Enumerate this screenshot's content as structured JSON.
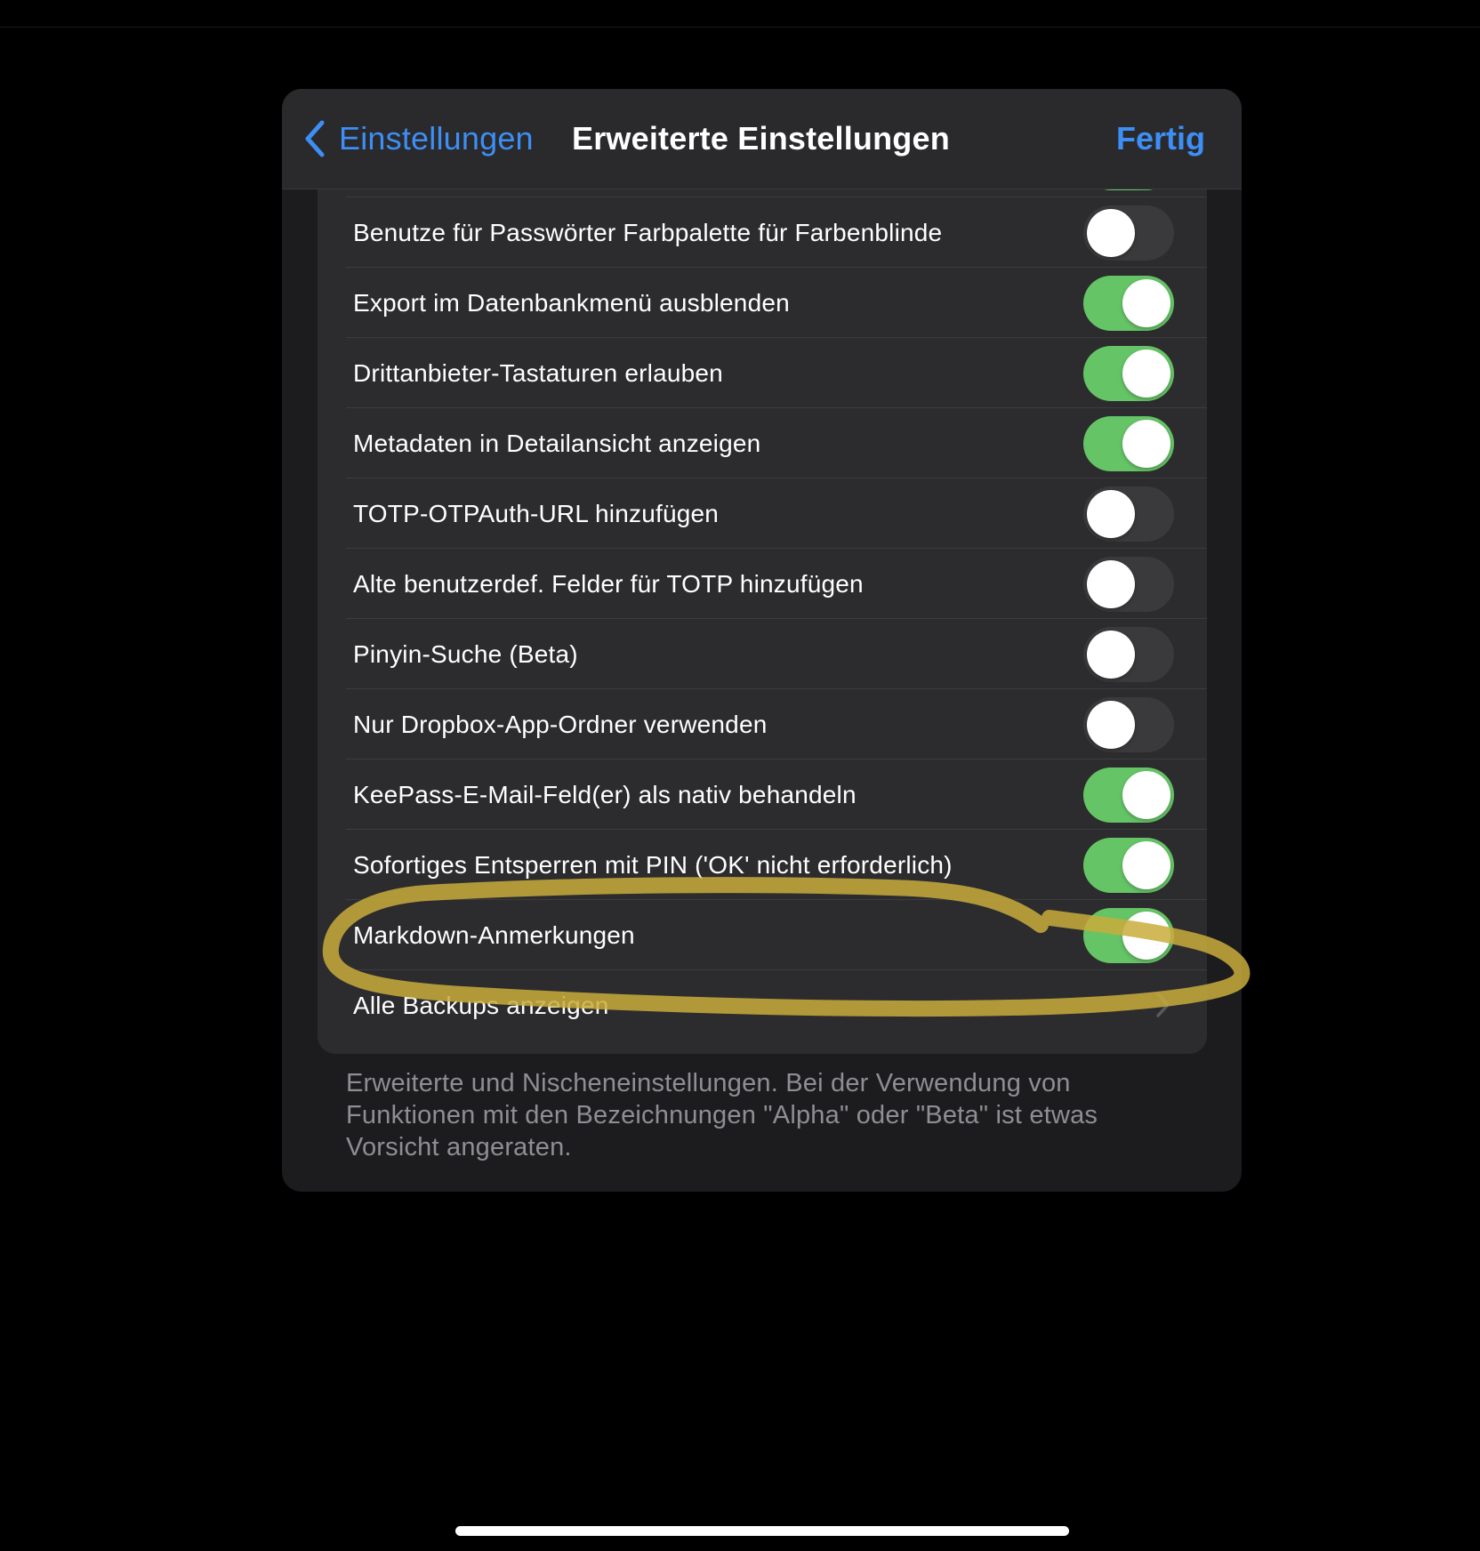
{
  "nav": {
    "back_label": "Einstellungen",
    "title": "Erweiterte Einstellungen",
    "done_label": "Fertig"
  },
  "rows": [
    {
      "label": "",
      "type": "toggle",
      "on": true
    },
    {
      "label": "Benutze für Passwörter Farbpalette für Farbenblinde",
      "type": "toggle",
      "on": false
    },
    {
      "label": "Export im Datenbankmenü ausblenden",
      "type": "toggle",
      "on": true
    },
    {
      "label": "Drittanbieter-Tastaturen erlauben",
      "type": "toggle",
      "on": true
    },
    {
      "label": "Metadaten in Detailansicht anzeigen",
      "type": "toggle",
      "on": true
    },
    {
      "label": "TOTP-OTPAuth-URL hinzufügen",
      "type": "toggle",
      "on": false
    },
    {
      "label": "Alte benutzerdef. Felder für TOTP hinzufügen",
      "type": "toggle",
      "on": false
    },
    {
      "label": "Pinyin-Suche (Beta)",
      "type": "toggle",
      "on": false
    },
    {
      "label": "Nur Dropbox-App-Ordner verwenden",
      "type": "toggle",
      "on": false
    },
    {
      "label": "KeePass-E-Mail-Feld(er) als nativ behandeln",
      "type": "toggle",
      "on": true
    },
    {
      "label": "Sofortiges Entsperren mit PIN ('OK' nicht erforderlich)",
      "type": "toggle",
      "on": true
    },
    {
      "label": "Markdown-Anmerkungen",
      "type": "toggle",
      "on": true
    },
    {
      "label": "Alle Backups anzeigen",
      "type": "link"
    }
  ],
  "footer": "Erweiterte und Nischeneinstellungen. Bei der Verwendung von Funktionen mit den Bezeichnungen \"Alpha\" oder \"Beta\" ist etwas Vorsicht angeraten.",
  "colors": {
    "accent": "#3d8ef5",
    "toggle_on": "#65c466",
    "toggle_off": "#3a3a3c",
    "highlight_marker": "#c9ad3c"
  },
  "icons": {
    "back": "chevron-left-icon",
    "disclosure": "chevron-right-icon"
  }
}
